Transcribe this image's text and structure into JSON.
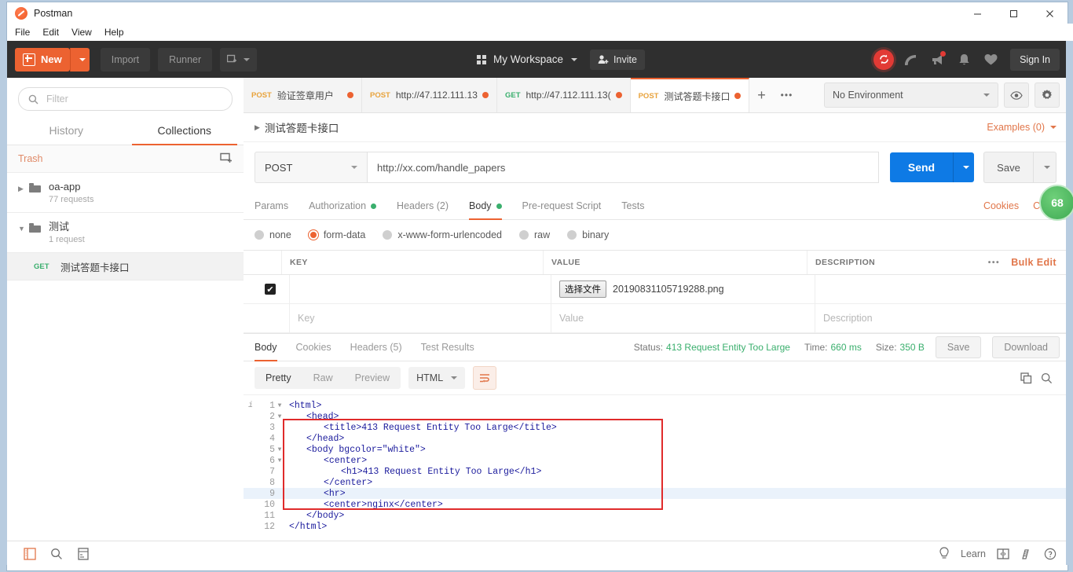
{
  "window": {
    "title": "Postman",
    "controls": {
      "minimize": "minimize-icon",
      "maximize": "maximize-icon",
      "close": "close-icon"
    }
  },
  "menu": {
    "items": [
      "File",
      "Edit",
      "View",
      "Help"
    ]
  },
  "toolbar": {
    "new_label": "New",
    "import_label": "Import",
    "runner_label": "Runner",
    "workspace_label": "My Workspace",
    "invite_label": "Invite",
    "sign_in_label": "Sign In",
    "icons": [
      "sync-icon",
      "satellite-icon",
      "megaphone-icon",
      "bell-icon",
      "heart-icon"
    ]
  },
  "sidebar": {
    "filter_placeholder": "Filter",
    "tabs": [
      {
        "label": "History",
        "active": false
      },
      {
        "label": "Collections",
        "active": true
      }
    ],
    "trash_label": "Trash",
    "new_folder_icon": "new-collection-icon",
    "collections": [
      {
        "name": "oa-app",
        "sub": "77 requests",
        "expanded": false
      },
      {
        "name": "测试",
        "sub": "1 request",
        "expanded": true
      }
    ],
    "requests": [
      {
        "method": "GET",
        "name": "测试答题卡接口",
        "selected": true
      }
    ]
  },
  "tabs": [
    {
      "method": "POST",
      "title": "验证签章用户",
      "unsaved": true,
      "active": false
    },
    {
      "method": "POST",
      "title": "http://47.112.111.13",
      "unsaved": true,
      "active": false
    },
    {
      "method": "GET",
      "title": "http://47.112.111.13(",
      "unsaved": true,
      "active": false
    },
    {
      "method": "POST",
      "title": "测试答题卡接口",
      "unsaved": true,
      "active": true
    }
  ],
  "tab_actions": {
    "add": "+",
    "more": "•••"
  },
  "environment": {
    "selected": "No Environment",
    "eye_icon": "eye-icon",
    "settings_icon": "gear-icon"
  },
  "request": {
    "name": "测试答题卡接口",
    "examples_label": "Examples (0)",
    "method": "POST",
    "url": "http://xx.com/handle_papers",
    "send_label": "Send",
    "save_label": "Save",
    "tabs": [
      {
        "label": "Params",
        "badge": "",
        "active": false
      },
      {
        "label": "Authorization",
        "badge": "dot",
        "active": false
      },
      {
        "label": "Headers (2)",
        "badge": "",
        "active": false
      },
      {
        "label": "Body",
        "badge": "dot",
        "active": true
      },
      {
        "label": "Pre-request Script",
        "badge": "",
        "active": false
      },
      {
        "label": "Tests",
        "badge": "",
        "active": false
      }
    ],
    "links": [
      "Cookies",
      "Code"
    ],
    "body_modes": [
      {
        "label": "none",
        "selected": false
      },
      {
        "label": "form-data",
        "selected": true
      },
      {
        "label": "x-www-form-urlencoded",
        "selected": false
      },
      {
        "label": "raw",
        "selected": false
      },
      {
        "label": "binary",
        "selected": false
      }
    ],
    "table": {
      "headers": [
        "KEY",
        "VALUE",
        "DESCRIPTION"
      ],
      "bulk_edit_label": "Bulk Edit",
      "more_label": "•••",
      "rows": [
        {
          "checked": true,
          "key": "",
          "file_button": "选择文件",
          "file_name": "20190831105719288.png",
          "description": ""
        }
      ],
      "placeholders": {
        "key": "Key",
        "value": "Value",
        "description": "Description"
      }
    }
  },
  "response": {
    "tabs": [
      {
        "label": "Body",
        "active": true
      },
      {
        "label": "Cookies",
        "active": false
      },
      {
        "label": "Headers (5)",
        "active": false
      },
      {
        "label": "Test Results",
        "active": false
      }
    ],
    "status_label": "Status:",
    "status_value": "413 Request Entity Too Large",
    "time_label": "Time:",
    "time_value": "660 ms",
    "size_label": "Size:",
    "size_value": "350 B",
    "save_label": "Save",
    "download_label": "Download",
    "view_modes": [
      {
        "label": "Pretty",
        "active": true
      },
      {
        "label": "Raw",
        "active": false
      },
      {
        "label": "Preview",
        "active": false
      }
    ],
    "format": "HTML",
    "wrap_icon": "word-wrap-icon",
    "copy_icon": "copy-icon",
    "search_icon": "search-icon",
    "code_lines": [
      {
        "n": 1,
        "fold": true,
        "indent": 0,
        "text": "<html>"
      },
      {
        "n": 2,
        "fold": true,
        "indent": 1,
        "text": "<head>"
      },
      {
        "n": 3,
        "fold": false,
        "indent": 2,
        "text": "<title>413 Request Entity Too Large</title>"
      },
      {
        "n": 4,
        "fold": false,
        "indent": 1,
        "text": "</head>"
      },
      {
        "n": 5,
        "fold": true,
        "indent": 1,
        "text": "<body bgcolor=\"white\">"
      },
      {
        "n": 6,
        "fold": true,
        "indent": 2,
        "text": "<center>"
      },
      {
        "n": 7,
        "fold": false,
        "indent": 3,
        "text": "<h1>413 Request Entity Too Large</h1>"
      },
      {
        "n": 8,
        "fold": false,
        "indent": 2,
        "text": "</center>"
      },
      {
        "n": 9,
        "fold": false,
        "indent": 2,
        "text": "<hr>",
        "highlight": true
      },
      {
        "n": 10,
        "fold": false,
        "indent": 2,
        "text": "<center>nginx</center>"
      },
      {
        "n": 11,
        "fold": false,
        "indent": 1,
        "text": "</body>"
      },
      {
        "n": 12,
        "fold": false,
        "indent": 0,
        "text": "</html>"
      }
    ],
    "annotation_box_color": "#e02b2b"
  },
  "floating_badge": {
    "value": "68",
    "color": "#3faa53"
  },
  "status_bar": {
    "left_icons": [
      "sidebar-toggle-icon",
      "find-icon",
      "console-icon"
    ],
    "learn_label": "Learn",
    "right_icons": [
      "bulb-icon",
      "two-pane-icon",
      "runner-icon",
      "help-icon"
    ]
  }
}
